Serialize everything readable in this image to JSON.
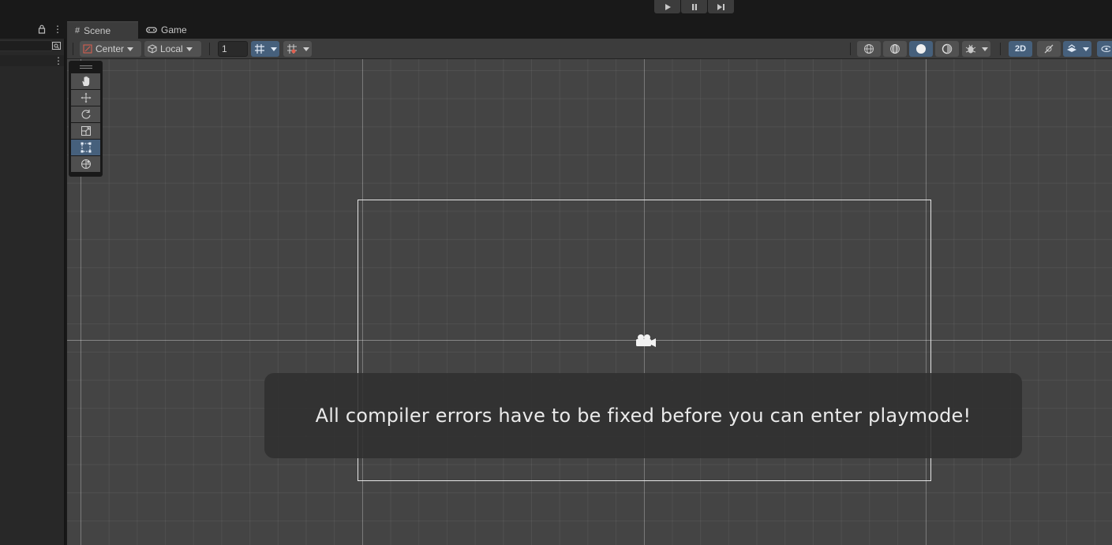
{
  "playbar": {
    "play_icon": "▶",
    "pause_icon": "❚❚",
    "step_icon": "▶|"
  },
  "hierarchy": {
    "lock_icon": "lock-icon",
    "menu_icon": "⋮"
  },
  "tabs": [
    {
      "label": "Scene",
      "icon": "#",
      "active": true
    },
    {
      "label": "Game",
      "icon": "⊶",
      "active": false
    }
  ],
  "toolbar": {
    "pivot_label": "Center",
    "space_label": "Local",
    "grid_value": "1",
    "mode_2d_label": "2D"
  },
  "tools": [
    "hand",
    "move",
    "rotate",
    "scale",
    "rect",
    "transform"
  ],
  "active_tool": "rect",
  "notification": {
    "message": "All compiler errors have to be fixed before you can enter playmode!"
  },
  "colors": {
    "accent": "#46607c",
    "viewport_bg": "#444444",
    "panel_bg": "#282828",
    "toolbar_bg": "#3c3c3c"
  }
}
